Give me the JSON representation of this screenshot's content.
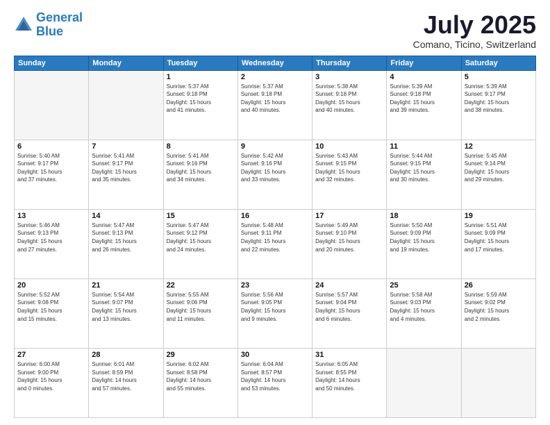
{
  "header": {
    "logo_line1": "General",
    "logo_line2": "Blue",
    "month": "July 2025",
    "location": "Comano, Ticino, Switzerland"
  },
  "weekdays": [
    "Sunday",
    "Monday",
    "Tuesday",
    "Wednesday",
    "Thursday",
    "Friday",
    "Saturday"
  ],
  "weeks": [
    [
      {
        "day": "",
        "detail": ""
      },
      {
        "day": "",
        "detail": ""
      },
      {
        "day": "1",
        "detail": "Sunrise: 5:37 AM\nSunset: 9:18 PM\nDaylight: 15 hours\nand 41 minutes."
      },
      {
        "day": "2",
        "detail": "Sunrise: 5:37 AM\nSunset: 9:18 PM\nDaylight: 15 hours\nand 40 minutes."
      },
      {
        "day": "3",
        "detail": "Sunrise: 5:38 AM\nSunset: 9:18 PM\nDaylight: 15 hours\nand 40 minutes."
      },
      {
        "day": "4",
        "detail": "Sunrise: 5:39 AM\nSunset: 9:18 PM\nDaylight: 15 hours\nand 39 minutes."
      },
      {
        "day": "5",
        "detail": "Sunrise: 5:39 AM\nSunset: 9:17 PM\nDaylight: 15 hours\nand 38 minutes."
      }
    ],
    [
      {
        "day": "6",
        "detail": "Sunrise: 5:40 AM\nSunset: 9:17 PM\nDaylight: 15 hours\nand 37 minutes."
      },
      {
        "day": "7",
        "detail": "Sunrise: 5:41 AM\nSunset: 9:17 PM\nDaylight: 15 hours\nand 35 minutes."
      },
      {
        "day": "8",
        "detail": "Sunrise: 5:41 AM\nSunset: 9:16 PM\nDaylight: 15 hours\nand 34 minutes."
      },
      {
        "day": "9",
        "detail": "Sunrise: 5:42 AM\nSunset: 9:16 PM\nDaylight: 15 hours\nand 33 minutes."
      },
      {
        "day": "10",
        "detail": "Sunrise: 5:43 AM\nSunset: 9:15 PM\nDaylight: 15 hours\nand 32 minutes."
      },
      {
        "day": "11",
        "detail": "Sunrise: 5:44 AM\nSunset: 9:15 PM\nDaylight: 15 hours\nand 30 minutes."
      },
      {
        "day": "12",
        "detail": "Sunrise: 5:45 AM\nSunset: 9:14 PM\nDaylight: 15 hours\nand 29 minutes."
      }
    ],
    [
      {
        "day": "13",
        "detail": "Sunrise: 5:46 AM\nSunset: 9:13 PM\nDaylight: 15 hours\nand 27 minutes."
      },
      {
        "day": "14",
        "detail": "Sunrise: 5:47 AM\nSunset: 9:13 PM\nDaylight: 15 hours\nand 26 minutes."
      },
      {
        "day": "15",
        "detail": "Sunrise: 5:47 AM\nSunset: 9:12 PM\nDaylight: 15 hours\nand 24 minutes."
      },
      {
        "day": "16",
        "detail": "Sunrise: 5:48 AM\nSunset: 9:11 PM\nDaylight: 15 hours\nand 22 minutes."
      },
      {
        "day": "17",
        "detail": "Sunrise: 5:49 AM\nSunset: 9:10 PM\nDaylight: 15 hours\nand 20 minutes."
      },
      {
        "day": "18",
        "detail": "Sunrise: 5:50 AM\nSunset: 9:09 PM\nDaylight: 15 hours\nand 19 minutes."
      },
      {
        "day": "19",
        "detail": "Sunrise: 5:51 AM\nSunset: 9:09 PM\nDaylight: 15 hours\nand 17 minutes."
      }
    ],
    [
      {
        "day": "20",
        "detail": "Sunrise: 5:52 AM\nSunset: 9:08 PM\nDaylight: 15 hours\nand 15 minutes."
      },
      {
        "day": "21",
        "detail": "Sunrise: 5:54 AM\nSunset: 9:07 PM\nDaylight: 15 hours\nand 13 minutes."
      },
      {
        "day": "22",
        "detail": "Sunrise: 5:55 AM\nSunset: 9:06 PM\nDaylight: 15 hours\nand 11 minutes."
      },
      {
        "day": "23",
        "detail": "Sunrise: 5:56 AM\nSunset: 9:05 PM\nDaylight: 15 hours\nand 9 minutes."
      },
      {
        "day": "24",
        "detail": "Sunrise: 5:57 AM\nSunset: 9:04 PM\nDaylight: 15 hours\nand 6 minutes."
      },
      {
        "day": "25",
        "detail": "Sunrise: 5:58 AM\nSunset: 9:03 PM\nDaylight: 15 hours\nand 4 minutes."
      },
      {
        "day": "26",
        "detail": "Sunrise: 5:59 AM\nSunset: 9:02 PM\nDaylight: 15 hours\nand 2 minutes."
      }
    ],
    [
      {
        "day": "27",
        "detail": "Sunrise: 6:00 AM\nSunset: 9:00 PM\nDaylight: 15 hours\nand 0 minutes."
      },
      {
        "day": "28",
        "detail": "Sunrise: 6:01 AM\nSunset: 8:59 PM\nDaylight: 14 hours\nand 57 minutes."
      },
      {
        "day": "29",
        "detail": "Sunrise: 6:02 AM\nSunset: 8:58 PM\nDaylight: 14 hours\nand 55 minutes."
      },
      {
        "day": "30",
        "detail": "Sunrise: 6:04 AM\nSunset: 8:57 PM\nDaylight: 14 hours\nand 53 minutes."
      },
      {
        "day": "31",
        "detail": "Sunrise: 6:05 AM\nSunset: 8:55 PM\nDaylight: 14 hours\nand 50 minutes."
      },
      {
        "day": "",
        "detail": ""
      },
      {
        "day": "",
        "detail": ""
      }
    ]
  ]
}
